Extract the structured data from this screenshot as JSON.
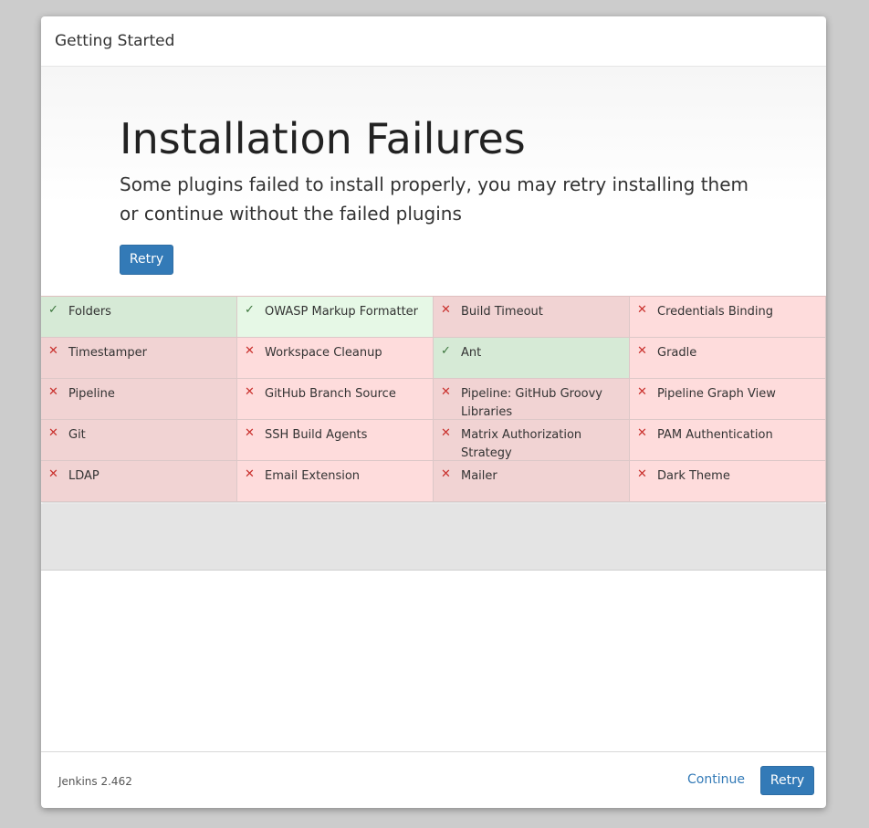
{
  "header": {
    "title": "Getting Started"
  },
  "jumbotron": {
    "heading": "Installation Failures",
    "description": "Some plugins failed to install properly, you may retry installing them or continue without the failed plugins",
    "retry_label": "Retry"
  },
  "plugins": [
    {
      "name": "Folders",
      "status": "success"
    },
    {
      "name": "OWASP Markup Formatter",
      "status": "success"
    },
    {
      "name": "Build Timeout",
      "status": "fail"
    },
    {
      "name": "Credentials Binding",
      "status": "fail"
    },
    {
      "name": "Timestamper",
      "status": "fail"
    },
    {
      "name": "Workspace Cleanup",
      "status": "fail"
    },
    {
      "name": "Ant",
      "status": "success"
    },
    {
      "name": "Gradle",
      "status": "fail"
    },
    {
      "name": "Pipeline",
      "status": "fail"
    },
    {
      "name": "GitHub Branch Source",
      "status": "fail"
    },
    {
      "name": "Pipeline: GitHub Groovy Libraries",
      "status": "fail"
    },
    {
      "name": "Pipeline Graph View",
      "status": "fail"
    },
    {
      "name": "Git",
      "status": "fail"
    },
    {
      "name": "SSH Build Agents",
      "status": "fail"
    },
    {
      "name": "Matrix Authorization Strategy",
      "status": "fail"
    },
    {
      "name": "PAM Authentication",
      "status": "fail"
    },
    {
      "name": "LDAP",
      "status": "fail"
    },
    {
      "name": "Email Extension",
      "status": "fail"
    },
    {
      "name": "Mailer",
      "status": "fail"
    },
    {
      "name": "Dark Theme",
      "status": "fail"
    }
  ],
  "icons": {
    "success": "check-icon",
    "fail": "cross-icon"
  },
  "colors": {
    "accent": "#337ab7",
    "success_bg": "#d6ead6",
    "fail_bg": "#f1d3d3"
  },
  "footer": {
    "version": "Jenkins 2.462",
    "continue_label": "Continue",
    "retry_label": "Retry"
  }
}
